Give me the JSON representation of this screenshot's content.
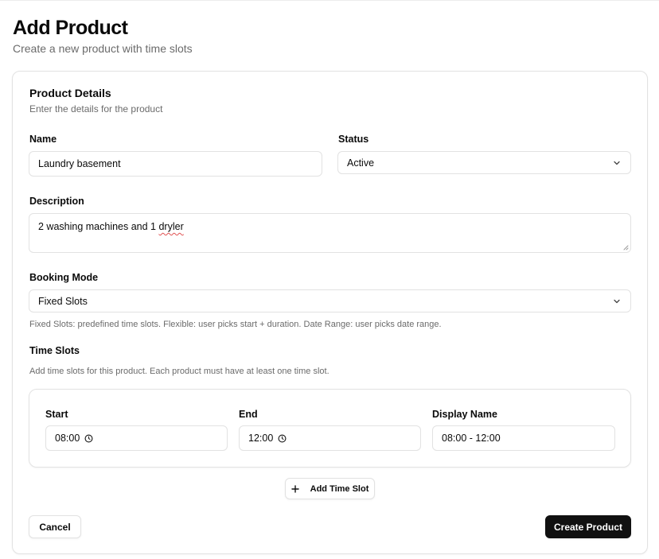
{
  "page": {
    "title": "Add Product",
    "subtitle": "Create a new product with time slots"
  },
  "card": {
    "title": "Product Details",
    "description": "Enter the details for the product"
  },
  "form": {
    "name": {
      "label": "Name",
      "value": "Laundry basement"
    },
    "status": {
      "label": "Status",
      "value": "Active"
    },
    "description": {
      "label": "Description",
      "value_prefix": "2 washing machines and 1 ",
      "value_misspelled": "dryler"
    },
    "booking_mode": {
      "label": "Booking Mode",
      "value": "Fixed Slots",
      "help": "Fixed Slots: predefined time slots. Flexible: user picks start + duration. Date Range: user picks date range."
    },
    "time_slots": {
      "label": "Time Slots",
      "help": "Add time slots for this product. Each product must have at least one time slot.",
      "columns": {
        "start": "Start",
        "end": "End",
        "display_name": "Display Name"
      },
      "rows": [
        {
          "start": "08:00",
          "end": "12:00",
          "display_name": "08:00 - 12:00"
        }
      ],
      "add_label": "Add Time Slot"
    }
  },
  "actions": {
    "cancel": "Cancel",
    "create": "Create Product"
  },
  "icons": {
    "status_select": "chevron-down-icon",
    "booking_select": "chevron-down-icon",
    "time_picker": "clock-icon",
    "add_slot": "plus-icon"
  },
  "colors": {
    "primary_button": "#111111",
    "border": "#e2e2e2",
    "muted_text": "#6b6b6b",
    "spellcheck": "#e05252"
  }
}
